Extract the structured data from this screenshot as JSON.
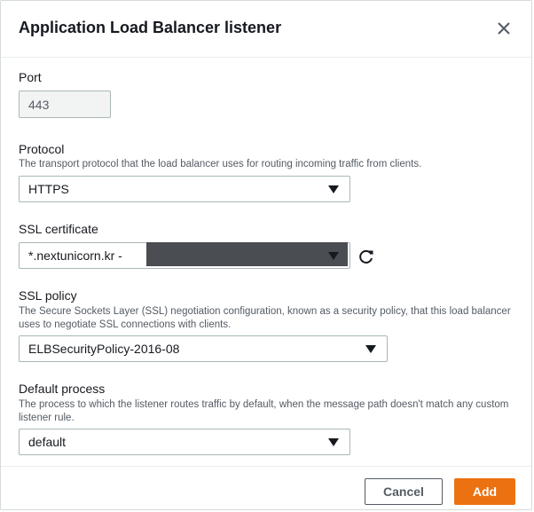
{
  "modal": {
    "title": "Application Load Balancer listener",
    "close_icon": "close-icon"
  },
  "port": {
    "label": "Port",
    "value": "443"
  },
  "protocol": {
    "label": "Protocol",
    "description": "The transport protocol that the load balancer uses for routing incoming traffic from clients.",
    "value": "HTTPS"
  },
  "ssl_certificate": {
    "label": "SSL certificate",
    "value": "*.nextunicorn.kr -",
    "refresh_icon": "refresh-icon"
  },
  "ssl_policy": {
    "label": "SSL policy",
    "description": "The Secure Sockets Layer (SSL) negotiation configuration, known as a security policy, that this load balancer uses to negotiate SSL connections with clients.",
    "value": "ELBSecurityPolicy-2016-08"
  },
  "default_process": {
    "label": "Default process",
    "description": "The process to which the listener routes traffic by default, when the message path doesn't match any custom listener rule.",
    "value": "default"
  },
  "footer": {
    "cancel_label": "Cancel",
    "add_label": "Add"
  },
  "colors": {
    "primary": "#ec7211",
    "text": "#16191f",
    "muted": "#545b64",
    "border": "#aab7b8"
  }
}
